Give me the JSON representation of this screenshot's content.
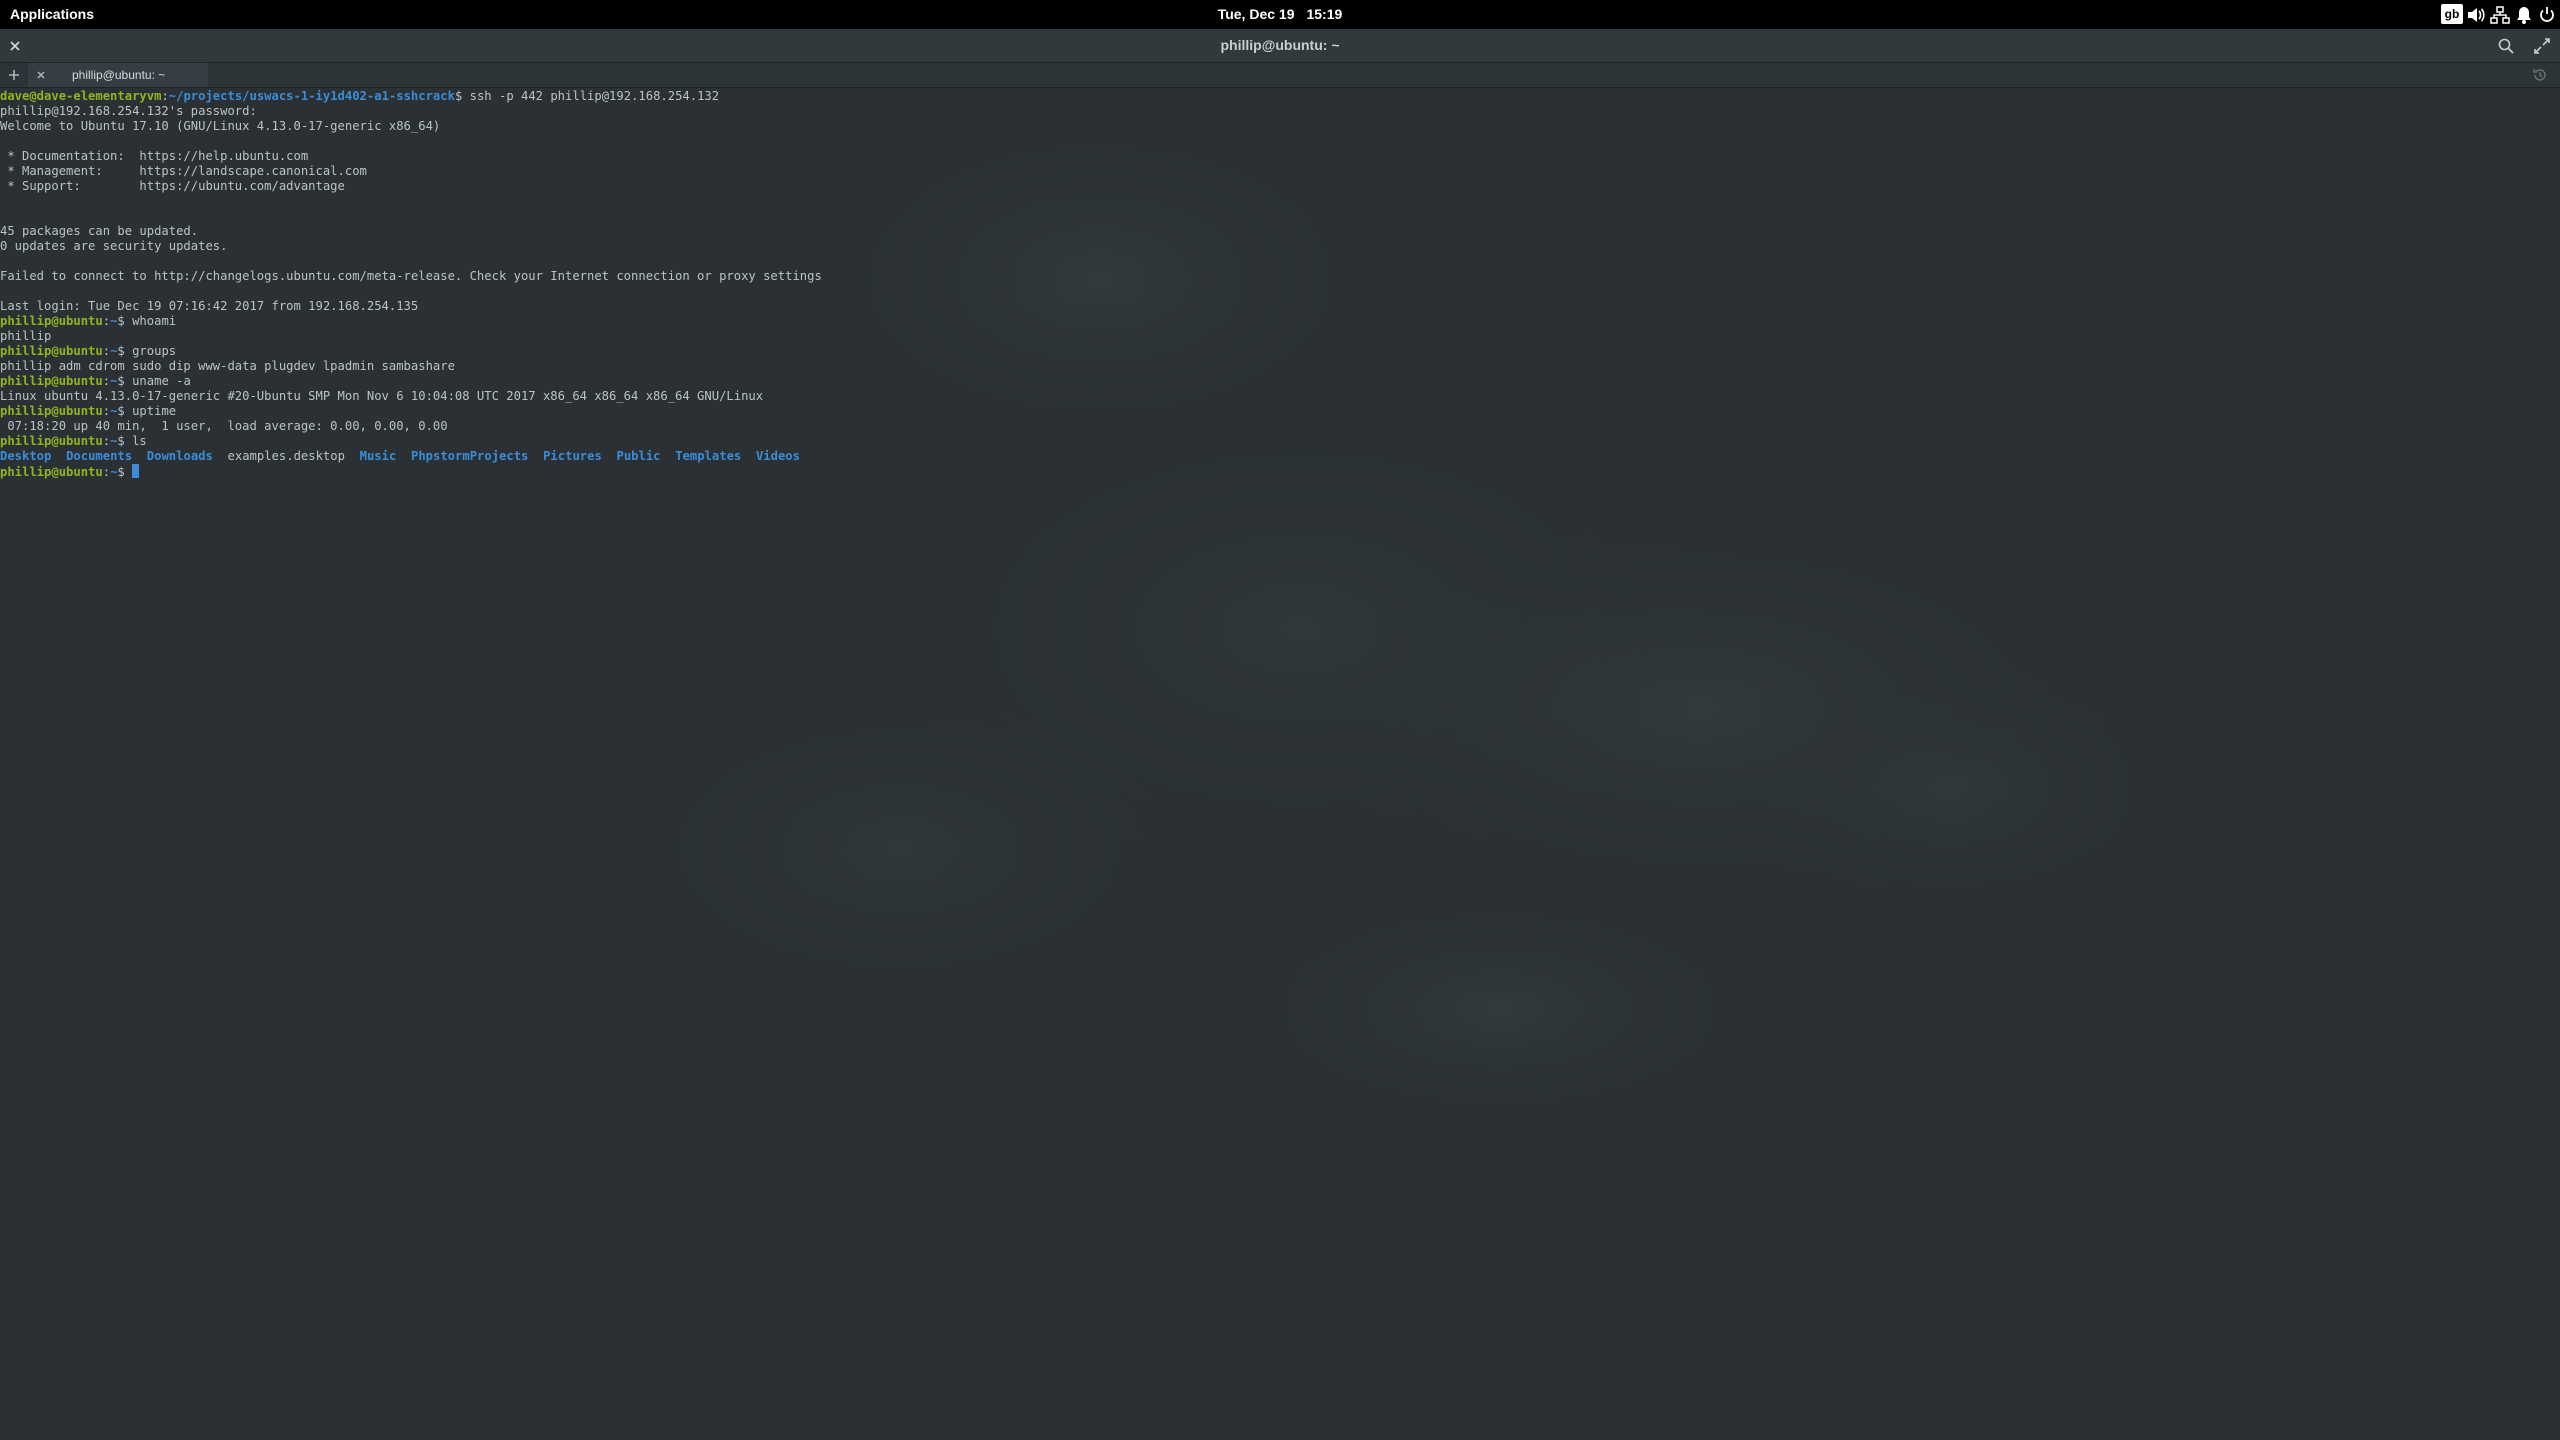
{
  "panel": {
    "applications_label": "Applications",
    "clock_date": "Tue, Dec 19",
    "clock_time": "15:19",
    "keyboard_layout": "gb",
    "icons": [
      "volume-icon",
      "network-icon",
      "notifications-icon",
      "power-icon"
    ]
  },
  "window": {
    "title": "phillip@ubuntu: ~",
    "tab_label": "phillip@ubuntu: ~"
  },
  "colors": {
    "background": "#282e32",
    "prompt_user": "#93b31f",
    "prompt_path": "#3b8dd8",
    "directory": "#3b8dd8",
    "text": "#bcc3c6"
  },
  "terminal": {
    "l1_user": "dave@dave-elementaryvm",
    "l1_sep": ":",
    "l1_path": "~/projects/uswacs-1-iy1d402-a1-sshcrack",
    "l1_cmd": "$ ssh -p 442 phillip@192.168.254.132",
    "l2": "phillip@192.168.254.132's password:",
    "l3": "Welcome to Ubuntu 17.10 (GNU/Linux 4.13.0-17-generic x86_64)",
    "l5": " * Documentation:  https://help.ubuntu.com",
    "l6": " * Management:     https://landscape.canonical.com",
    "l7": " * Support:        https://ubuntu.com/advantage",
    "l10": "45 packages can be updated.",
    "l11": "0 updates are security updates.",
    "l13": "Failed to connect to http://changelogs.ubuntu.com/meta-release. Check your Internet connection or proxy settings",
    "l15": "Last login: Tue Dec 19 07:16:42 2017 from 192.168.254.135",
    "prompt_user": "phillip@ubuntu",
    "prompt_sep": ":",
    "prompt_path": "~",
    "cmd_whoami": "$ whoami",
    "out_whoami": "phillip",
    "cmd_groups": "$ groups",
    "out_groups": "phillip adm cdrom sudo dip www-data plugdev lpadmin sambashare",
    "cmd_uname": "$ uname -a",
    "out_uname": "Linux ubuntu 4.13.0-17-generic #20-Ubuntu SMP Mon Nov 6 10:04:08 UTC 2017 x86_64 x86_64 x86_64 GNU/Linux",
    "cmd_uptime": "$ uptime",
    "out_uptime": " 07:18:20 up 40 min,  1 user,  load average: 0.00, 0.00, 0.00",
    "cmd_ls": "$ ls",
    "ls_entries": [
      {
        "name": "Desktop",
        "type": "dir"
      },
      {
        "name": "Documents",
        "type": "dir"
      },
      {
        "name": "Downloads",
        "type": "dir"
      },
      {
        "name": "examples.desktop",
        "type": "file"
      },
      {
        "name": "Music",
        "type": "dir"
      },
      {
        "name": "PhpstormProjects",
        "type": "dir"
      },
      {
        "name": "Pictures",
        "type": "dir"
      },
      {
        "name": "Public",
        "type": "dir"
      },
      {
        "name": "Templates",
        "type": "dir"
      },
      {
        "name": "Videos",
        "type": "dir"
      }
    ],
    "last_prompt_suffix": "$ "
  }
}
